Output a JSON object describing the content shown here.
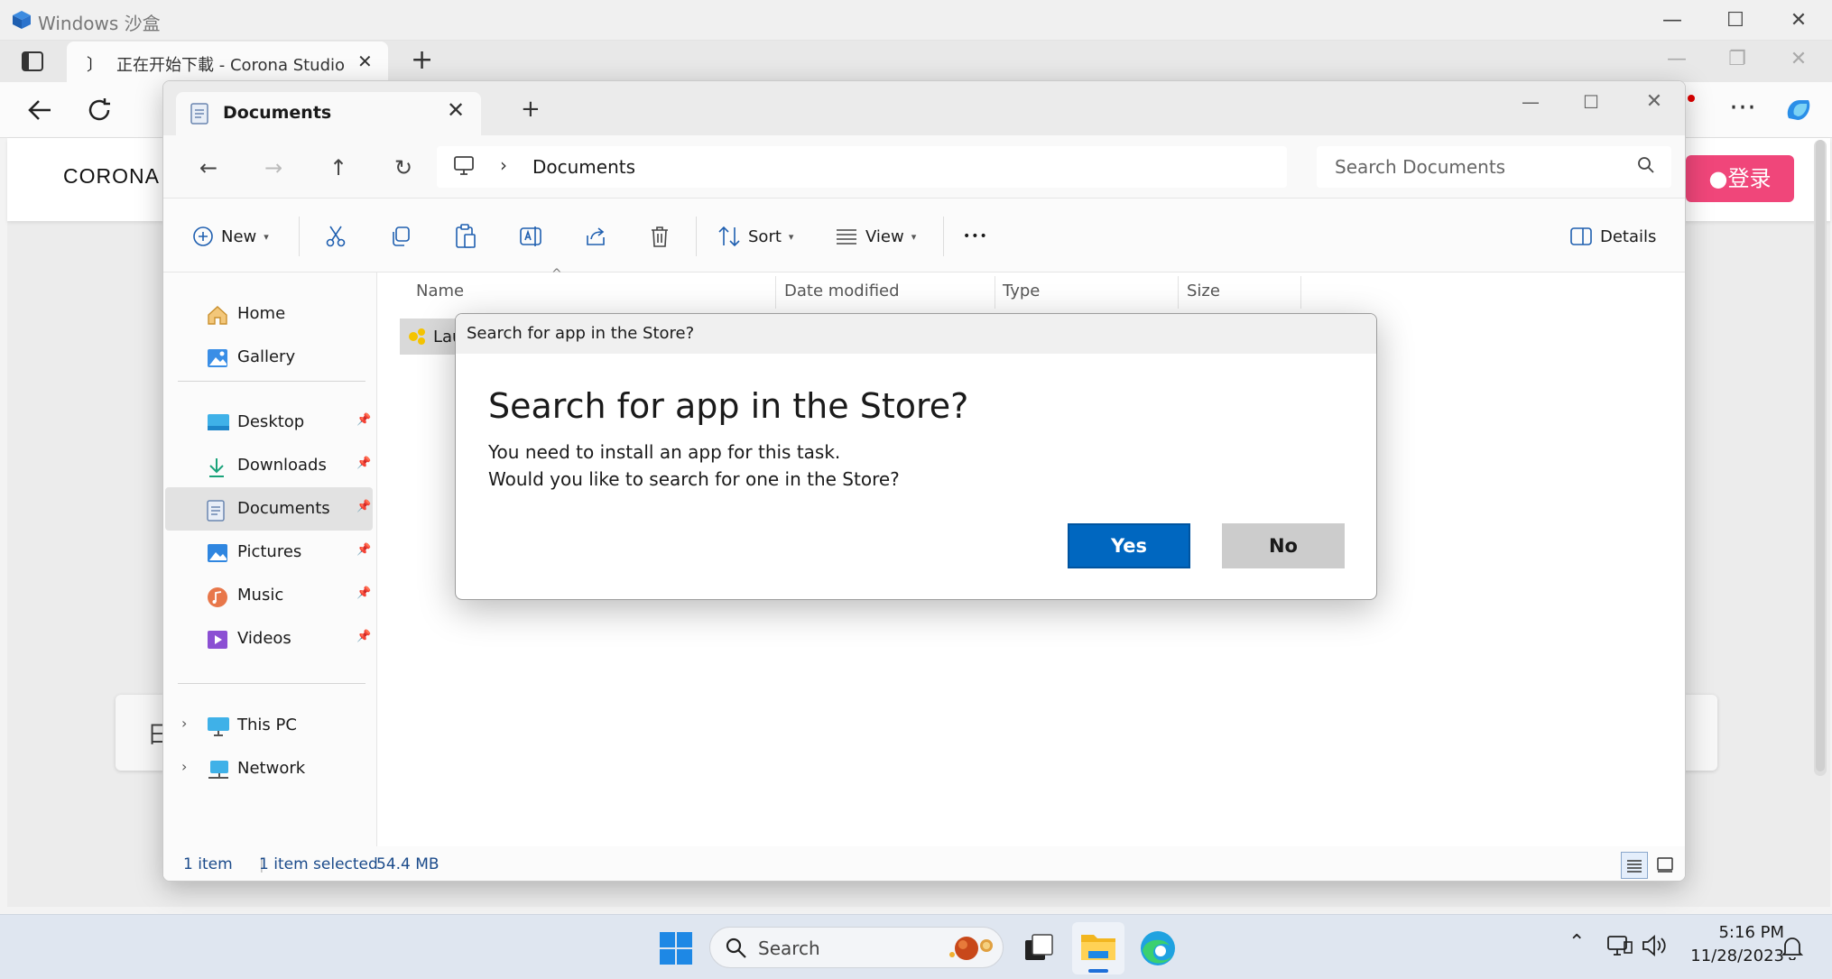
{
  "sandbox": {
    "title": "Windows 沙盒"
  },
  "browser": {
    "tab_title": "正在开始下載 - Corona Studio",
    "new_tab_label": "+"
  },
  "page": {
    "logo_text": "CORONA",
    "login_label": "登录",
    "card_text": "日"
  },
  "explorer": {
    "tab_title": "Documents",
    "new_tab_label": "+",
    "breadcrumb": "Documents",
    "search_placeholder": "Search Documents",
    "commands": {
      "new_label": "New",
      "sort_label": "Sort",
      "view_label": "View",
      "more_label": "•••",
      "details_label": "Details"
    },
    "nav": {
      "home": "Home",
      "gallery": "Gallery",
      "desktop": "Desktop",
      "downloads": "Downloads",
      "documents": "Documents",
      "pictures": "Pictures",
      "music": "Music",
      "videos": "Videos",
      "this_pc": "This PC",
      "network": "Network"
    },
    "columns": {
      "name": "Name",
      "date_modified": "Date modified",
      "type": "Type",
      "size": "Size"
    },
    "file": {
      "name_visible": "Lau"
    },
    "status": {
      "count": "1 item",
      "selected": "1 item selected",
      "size": "54.4 MB"
    }
  },
  "dialog": {
    "title": "Search for app in the Store?",
    "heading": "Search for app in the Store?",
    "line1": "You need to install an app for this task.",
    "line2": "Would you like to search for one in the Store?",
    "yes_label": "Yes",
    "no_label": "No"
  },
  "taskbar": {
    "search_placeholder": "Search",
    "time": "5:16 PM",
    "date": "11/28/2023"
  },
  "colors": {
    "accent_blue": "#0067c0",
    "login_pink": "#f0467a",
    "taskbar_bg": "#dfe6f0"
  }
}
